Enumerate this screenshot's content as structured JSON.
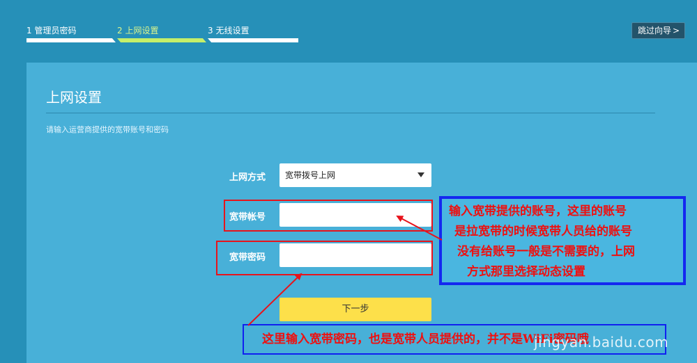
{
  "steps": [
    {
      "label": "1  管理员密码"
    },
    {
      "label": "2  上网设置"
    },
    {
      "label": "3  无线设置"
    }
  ],
  "skip_button": {
    "label": "跳过向导",
    "icon": "chevron-right-icon"
  },
  "panel": {
    "title": "上网设置",
    "description": "请输入运营商提供的宽带账号和密码"
  },
  "form": {
    "connection_type_label": "上网方式",
    "connection_type_value": "宽带拨号上网",
    "account_label": "宽带帐号",
    "account_value": "",
    "password_label": "宽带密码",
    "password_value": "",
    "next_button": "下一步"
  },
  "annotations": {
    "account_note": [
      "输入宽带提供的账号，这里的账号",
      "是拉宽带的时候宽带人员给的账号",
      "没有给账号一般是不需要的，上网",
      "方式那里选择动态设置"
    ],
    "password_note": "这里输入宽带密码，也是宽带人员提供的，并不是WiFi密码哦"
  },
  "watermark": "jingyan.baidu.com",
  "colors": {
    "background": "#2690b8",
    "panel": "#48b0d8",
    "active_step": "#c5ef6a",
    "next_button": "#fde04a",
    "annotation_red": "#e8131b",
    "annotation_blue": "#1020f0"
  }
}
